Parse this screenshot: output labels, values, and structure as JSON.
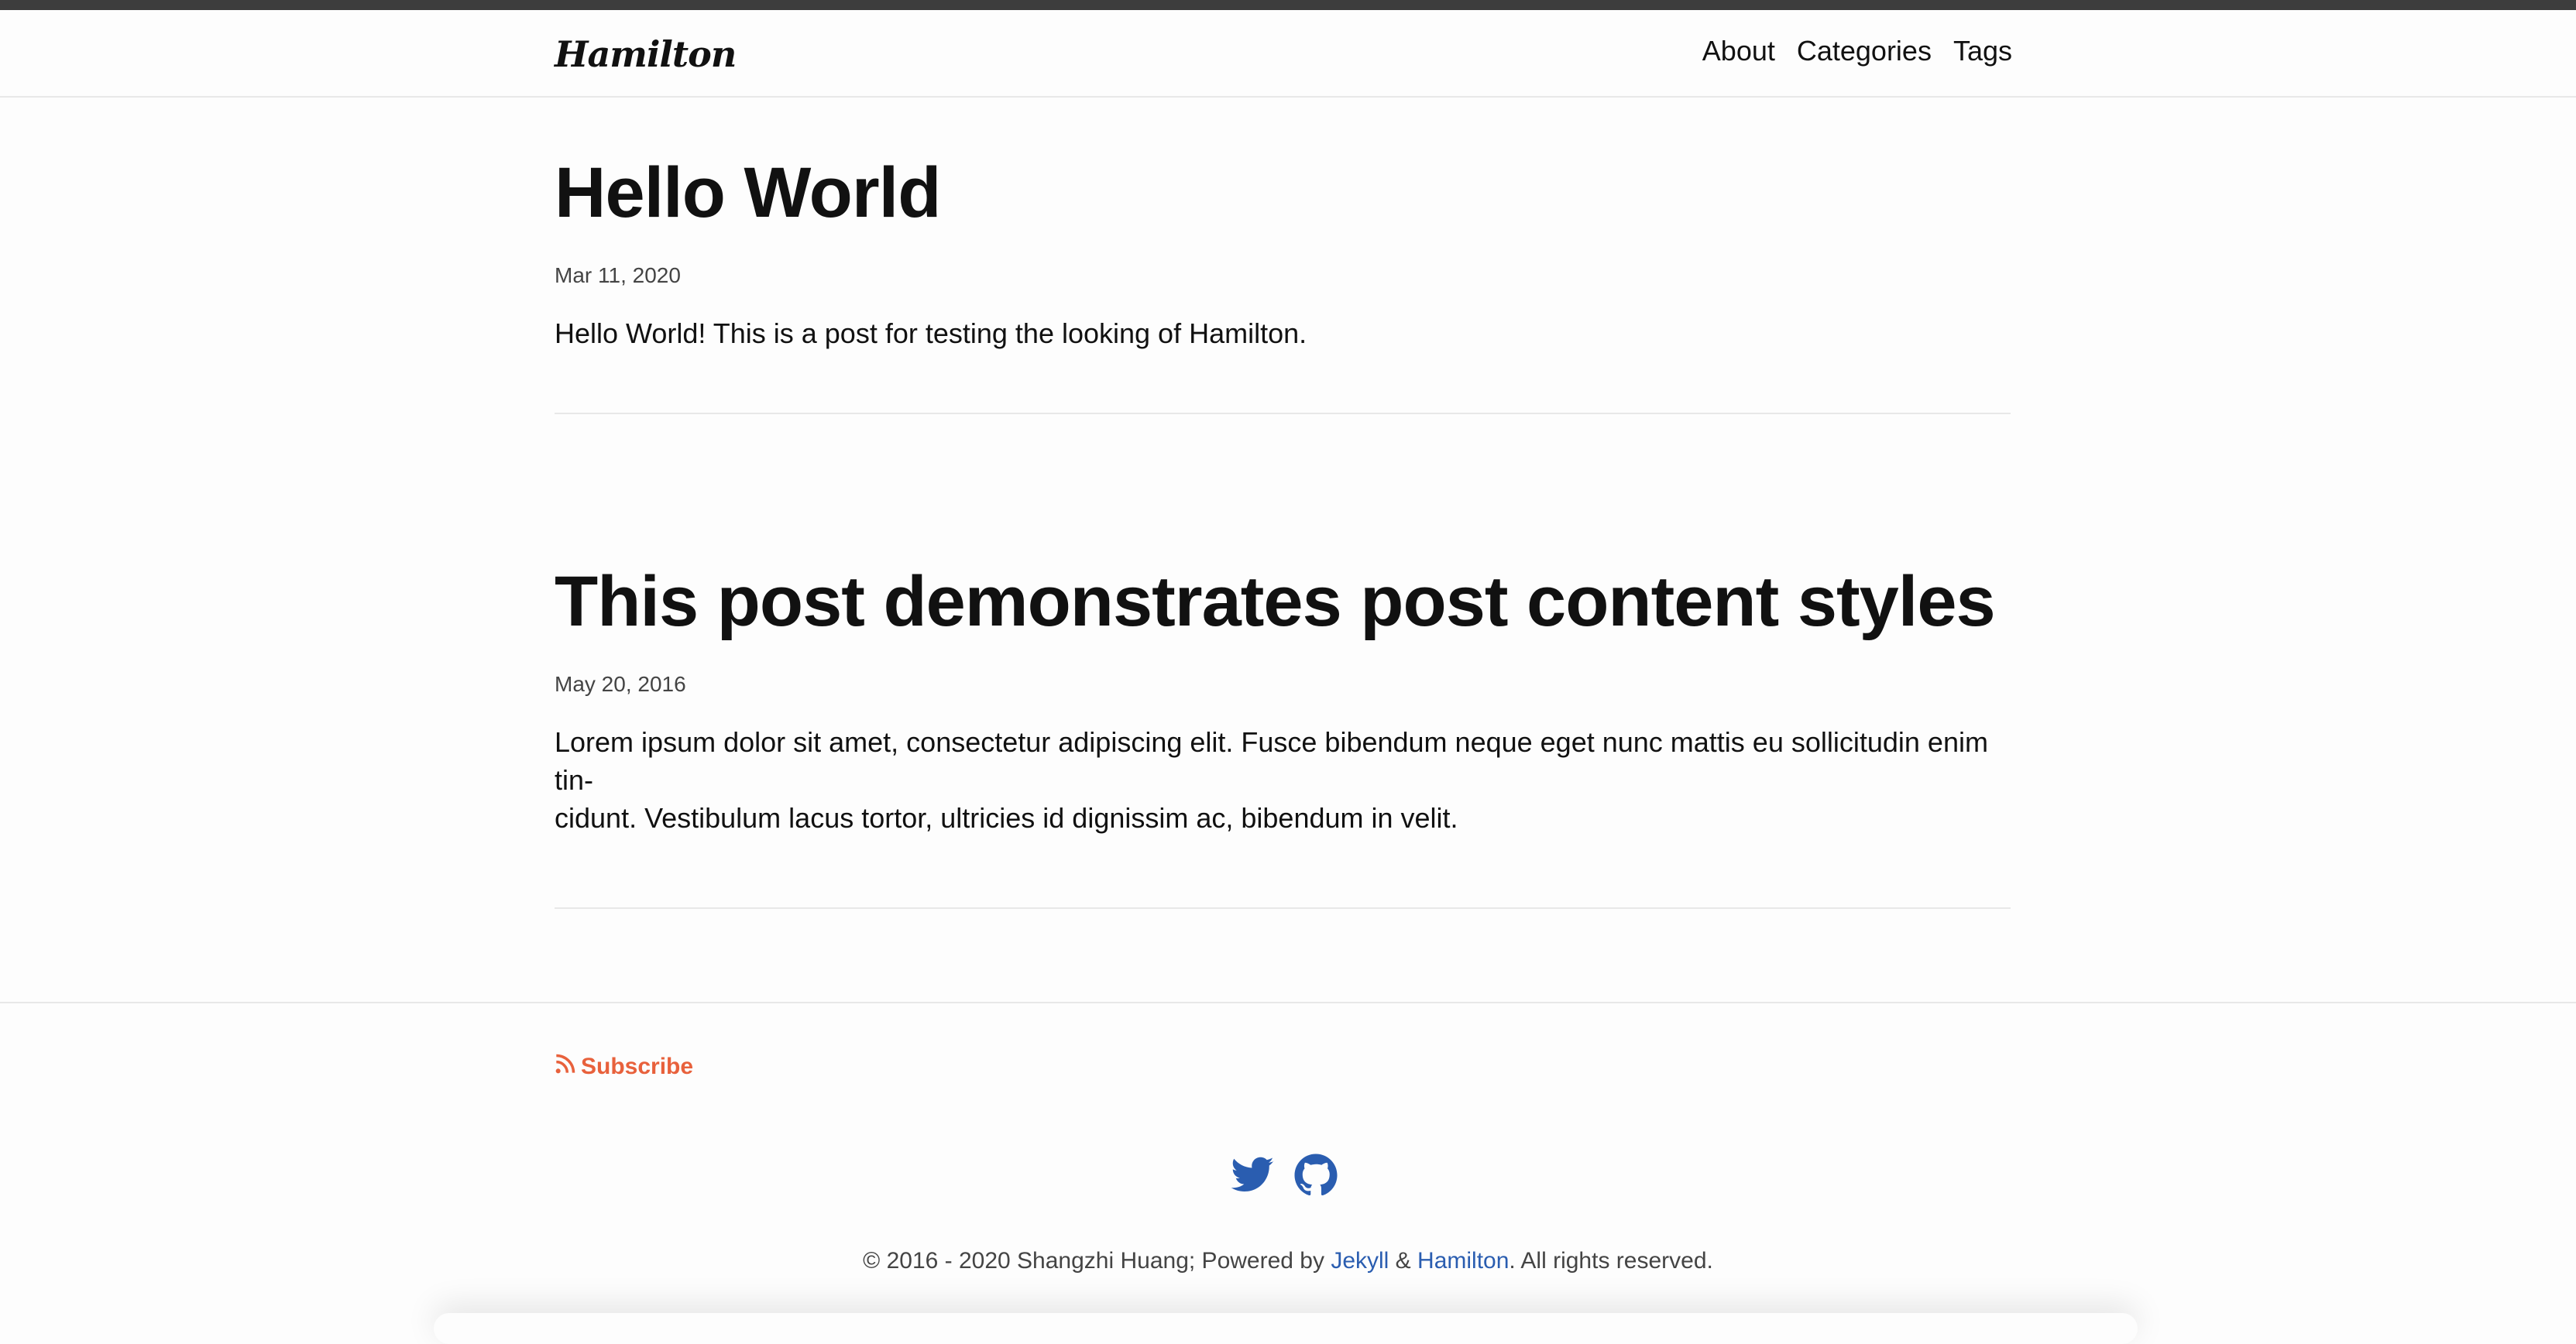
{
  "header": {
    "site_title": "Hamilton",
    "nav": [
      {
        "label": "About"
      },
      {
        "label": "Categories"
      },
      {
        "label": "Tags"
      }
    ]
  },
  "posts": [
    {
      "title": "Hello World",
      "date": "Mar 11, 2020",
      "excerpt": "Hello World! This is a post for testing the looking of Hamilton."
    },
    {
      "title": "This post demonstrates post content styles",
      "date": "May 20, 2016",
      "excerpt_line1": "Lorem ipsum dolor sit amet, consectetur adipiscing elit. Fusce bibendum neque eget nunc mattis eu sollicitudin enim tin-",
      "excerpt_line2": "cidunt. Vestibulum lacus tortor, ultricies id dignissim ac, bibendum in velit."
    }
  ],
  "footer": {
    "subscribe_label": "Subscribe",
    "subscribe_icon": "rss-icon",
    "social_icons": [
      "twitter-icon",
      "github-icon"
    ],
    "copyright_prefix": "© 2016 - 2020 Shangzhi Huang; Powered by ",
    "jekyll_link": "Jekyll",
    "ampersand": " & ",
    "hamilton_link": "Hamilton",
    "copyright_suffix": ". All rights reserved."
  },
  "colors": {
    "top_bar": "#3d3d3d",
    "subscribe": "#e8613c",
    "link": "#2a5db0",
    "social": "#2a5db0"
  }
}
